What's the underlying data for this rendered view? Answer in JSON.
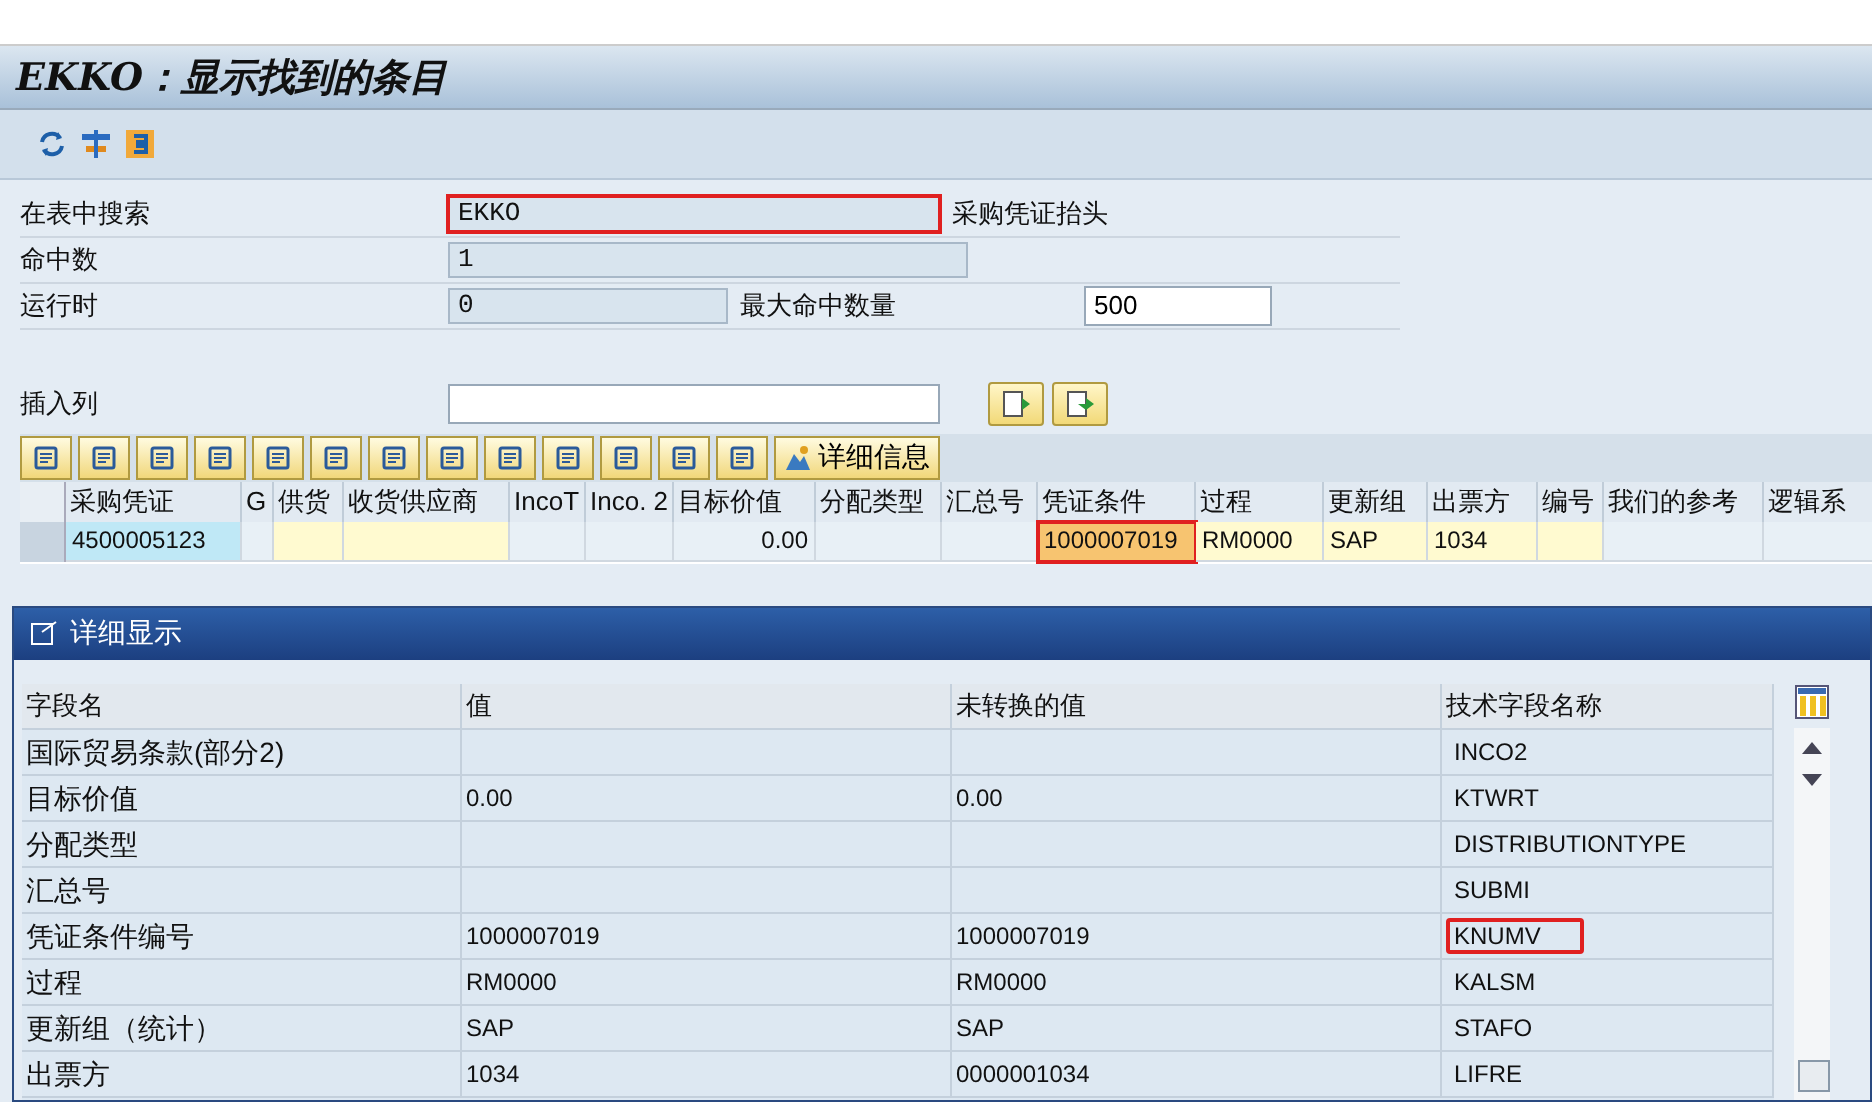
{
  "window": {
    "title": "EKKO：显示找到的条目"
  },
  "form": {
    "rows": [
      {
        "label": "在表中搜索",
        "value": "EKKO",
        "highlighted": true,
        "suffix": "采购凭证抬头"
      },
      {
        "label": "命中数",
        "value": "1",
        "highlighted": false
      },
      {
        "label": "运行时",
        "value": "0",
        "highlighted": false,
        "extra_label": "最大命中数量",
        "extra_value": "500"
      }
    ],
    "insert": {
      "label": "插入列"
    }
  },
  "detail_button": "详细信息",
  "table": {
    "columns": [
      {
        "label": "采购凭证",
        "kind": "key"
      },
      {
        "label": "G",
        "kind": "plain"
      },
      {
        "label": "供货",
        "kind": "yellow"
      },
      {
        "label": "收货供应商",
        "kind": "yellow"
      },
      {
        "label": "IncoT",
        "kind": "plain"
      },
      {
        "label": "Inco. 2",
        "kind": "plain"
      },
      {
        "label": "目标价值",
        "kind": "plain"
      },
      {
        "label": "分配类型",
        "kind": "plain"
      },
      {
        "label": "汇总号",
        "kind": "plain"
      },
      {
        "label": "凭证条件",
        "kind": "hot"
      },
      {
        "label": "过程",
        "kind": "yellow"
      },
      {
        "label": "更新组",
        "kind": "yellow"
      },
      {
        "label": "出票方",
        "kind": "yellow"
      },
      {
        "label": "编号",
        "kind": "yellow"
      },
      {
        "label": "我们的参考",
        "kind": "plain"
      },
      {
        "label": "逻辑系",
        "kind": "plain"
      }
    ],
    "rows": [
      {
        "cells": [
          "4500005123",
          "",
          "",
          "",
          "",
          "",
          "0.00",
          "",
          "",
          "1000007019",
          "RM0000",
          "SAP",
          "1034",
          "",
          "",
          ""
        ]
      }
    ]
  },
  "dialog": {
    "title": "详细显示",
    "columns": [
      "字段名",
      "值",
      "未转换的值",
      "技术字段名称"
    ],
    "rows": [
      {
        "cells": [
          "国际贸易条款(部分2)",
          "",
          "",
          "INCO2"
        ],
        "highlighted": false
      },
      {
        "cells": [
          "目标价值",
          "0.00",
          "0.00",
          "KTWRT"
        ],
        "highlighted": false
      },
      {
        "cells": [
          "分配类型",
          "",
          "",
          "DISTRIBUTIONTYPE"
        ],
        "highlighted": false
      },
      {
        "cells": [
          "汇总号",
          "",
          "",
          "SUBMI"
        ],
        "highlighted": false
      },
      {
        "cells": [
          "凭证条件编号",
          "1000007019",
          "1000007019",
          "KNUMV"
        ],
        "highlighted": true
      },
      {
        "cells": [
          "过程",
          "RM0000",
          "RM0000",
          "KALSM"
        ],
        "highlighted": false
      },
      {
        "cells": [
          "更新组（统计）",
          "SAP",
          "SAP",
          "STAFO"
        ],
        "highlighted": false
      },
      {
        "cells": [
          "出票方",
          "1034",
          "0000001034",
          "LIFRE"
        ],
        "highlighted": false
      }
    ]
  }
}
